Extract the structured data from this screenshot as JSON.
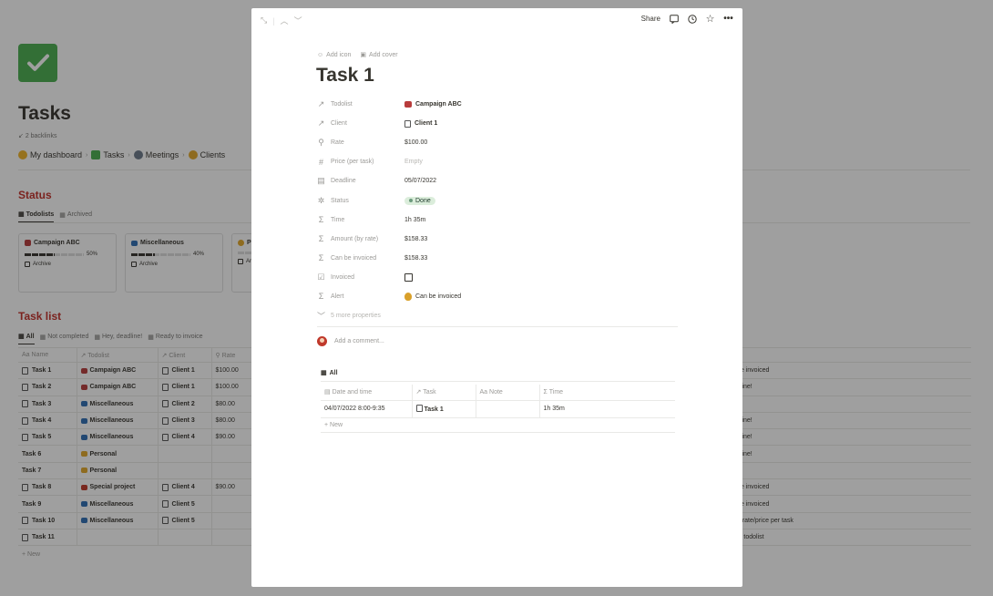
{
  "background": {
    "title": "Tasks",
    "backlinks": "2 backlinks",
    "breadcrumb": [
      "My dashboard",
      "Tasks",
      "Meetings",
      "Clients"
    ],
    "status": {
      "title": "Status",
      "tabs": [
        "Todolists",
        "Archived"
      ],
      "cards": [
        {
          "name": "Campaign ABC",
          "progress_label": "50%",
          "progress": 0.5,
          "archive": "Archive",
          "icon_color": "#b83c3c"
        },
        {
          "name": "Miscellaneous",
          "progress_label": "40%",
          "progress": 0.4,
          "archive": "Archive",
          "icon_color": "#2f6fb5"
        },
        {
          "name": "P",
          "progress_label": "",
          "progress": 0,
          "archive": "Ar",
          "icon_color": "#e3a82b"
        }
      ]
    },
    "tasklist": {
      "title": "Task list",
      "tabs": [
        "All",
        "Not completed",
        "Hey, deadline!",
        "Ready to invoice"
      ],
      "columns": [
        "Name",
        "Todolist",
        "Client",
        "Rate"
      ],
      "rows": [
        {
          "name": "Task 1",
          "doc": true,
          "todolist": "Campaign ABC",
          "todo_color": "#b83c3c",
          "client": "Client 1",
          "rate": "$100.00",
          "right": "be invoiced"
        },
        {
          "name": "Task 2",
          "doc": true,
          "todolist": "Campaign ABC",
          "todo_color": "#b83c3c",
          "client": "Client 1",
          "rate": "$100.00",
          "right": "dline!"
        },
        {
          "name": "Task 3",
          "doc": true,
          "todolist": "Miscellaneous",
          "todo_color": "#2f6fb5",
          "client": "Client 2",
          "rate": "$80.00",
          "right": ""
        },
        {
          "name": "Task 4",
          "doc": true,
          "todolist": "Miscellaneous",
          "todo_color": "#2f6fb5",
          "client": "Client 3",
          "rate": "$80.00",
          "right": "dline!"
        },
        {
          "name": "Task 5",
          "doc": true,
          "todolist": "Miscellaneous",
          "todo_color": "#2f6fb5",
          "client": "Client 4",
          "rate": "$90.00",
          "right": "dline!"
        },
        {
          "name": "Task 6",
          "doc": false,
          "todolist": "Personal",
          "todo_color": "#e3a82b",
          "client": "",
          "rate": "",
          "right": "dline!"
        },
        {
          "name": "Task 7",
          "doc": false,
          "todolist": "Personal",
          "todo_color": "#e3a82b",
          "client": "",
          "rate": "",
          "right": ""
        },
        {
          "name": "Task 8",
          "doc": true,
          "todolist": "Special project",
          "todo_color": "#c0392b",
          "client": "Client 4",
          "rate": "$90.00",
          "right": "be invoiced"
        },
        {
          "name": "Task 9",
          "doc": false,
          "todolist": "Miscellaneous",
          "todo_color": "#2f6fb5",
          "client": "Client 5",
          "rate": "",
          "right": "be invoiced"
        },
        {
          "name": "Task 10",
          "doc": true,
          "todolist": "Miscellaneous",
          "todo_color": "#2f6fb5",
          "client": "Client 5",
          "rate": "",
          "right": "n rate/price per task"
        },
        {
          "name": "Task 11",
          "doc": true,
          "todolist": "",
          "todo_color": "",
          "client": "",
          "rate": "",
          "right": "ct todolist"
        }
      ],
      "new_label": "+ New"
    }
  },
  "modal": {
    "share_label": "Share",
    "add_icon": "Add icon",
    "add_cover": "Add cover",
    "title": "Task 1",
    "properties": [
      {
        "name": "Todolist",
        "icon": "↗",
        "value": "Campaign ABC",
        "style": "bold",
        "kind": "relation-emoji"
      },
      {
        "name": "Client",
        "icon": "↗",
        "value": "Client 1",
        "style": "bold",
        "kind": "relation-doc"
      },
      {
        "name": "Rate",
        "icon": "⚲",
        "value": "$100.00",
        "style": "",
        "kind": "text"
      },
      {
        "name": "Price (per task)",
        "icon": "#",
        "value": "Empty",
        "style": "empty",
        "kind": "text"
      },
      {
        "name": "Deadline",
        "icon": "▤",
        "value": "05/07/2022",
        "style": "",
        "kind": "text"
      },
      {
        "name": "Status",
        "icon": "✲",
        "value": "Done",
        "style": "",
        "kind": "status"
      },
      {
        "name": "Time",
        "icon": "Σ",
        "value": "1h 35m",
        "style": "",
        "kind": "text"
      },
      {
        "name": "Amount (by rate)",
        "icon": "Σ",
        "value": "$158.33",
        "style": "",
        "kind": "text"
      },
      {
        "name": "Can be invoiced",
        "icon": "Σ",
        "value": "$158.33",
        "style": "",
        "kind": "text"
      },
      {
        "name": "Invoiced",
        "icon": "☑",
        "value": "",
        "style": "",
        "kind": "checkbox"
      },
      {
        "name": "Alert",
        "icon": "Σ",
        "value": "Can be invoiced",
        "style": "",
        "kind": "alert"
      }
    ],
    "more_properties": "5 more properties",
    "comment_placeholder": "Add a comment...",
    "inner_view": {
      "tab": "All",
      "columns": [
        "Date and time",
        "Task",
        "Note",
        "Time"
      ],
      "rows": [
        {
          "date": "04/07/2022 8:00-9:35",
          "task": "Task 1",
          "note": "",
          "time": "1h 35m"
        }
      ],
      "new_label": "+ New"
    }
  }
}
